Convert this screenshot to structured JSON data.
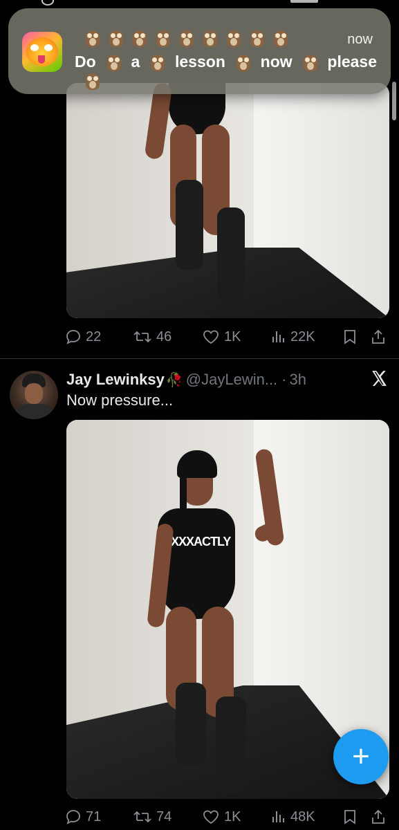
{
  "notification": {
    "time": "now",
    "word_do": "Do",
    "word_a": "a",
    "word_lesson": "lesson",
    "word_now": "now",
    "word_please": "please",
    "owl_icon": "owl-emoji"
  },
  "tweet1": {
    "actions": {
      "replies": "22",
      "reposts": "46",
      "likes": "1K",
      "views": "22K"
    }
  },
  "tweet2": {
    "name": "Jay Lewinksy",
    "name_emoji": "🥀",
    "handle": "@JayLewin...",
    "time_sep": "·",
    "time": "3h",
    "text": "Now pressure...",
    "shirt_text": "EXXXACTLY",
    "actions": {
      "replies": "71",
      "reposts": "74",
      "likes": "1K",
      "views": "48K"
    }
  },
  "fab": {
    "label": "+"
  },
  "colors": {
    "accent": "#1d9bf0",
    "background": "#000000",
    "muted_text": "#71767b"
  }
}
